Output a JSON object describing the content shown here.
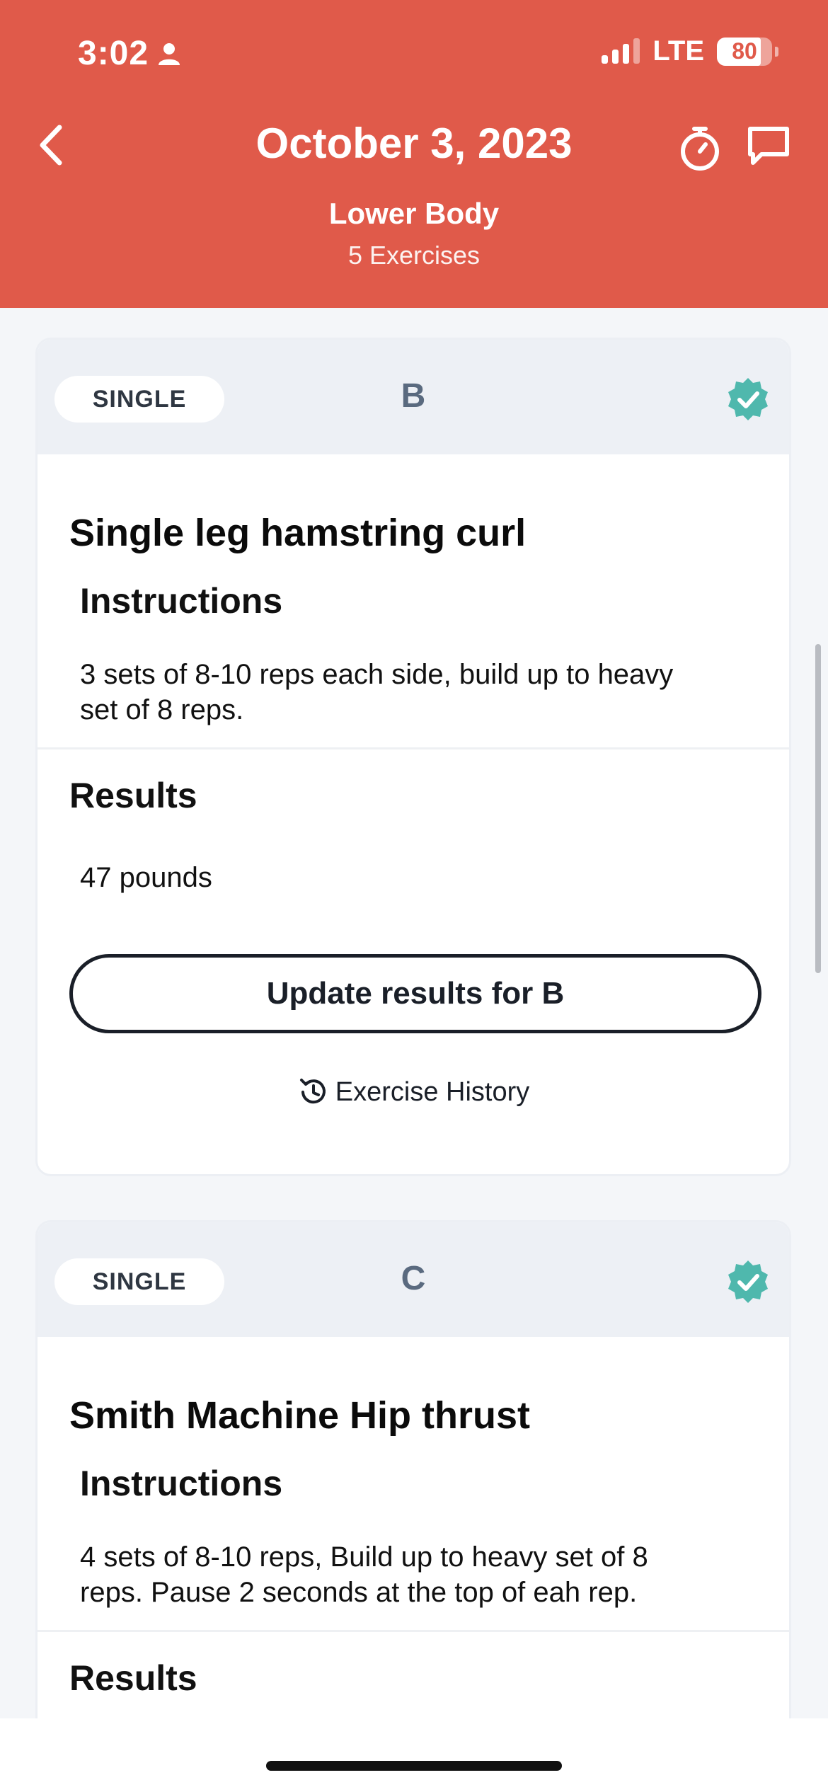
{
  "status": {
    "time": "3:02",
    "network": "LTE",
    "battery": "80"
  },
  "header": {
    "title": "October 3, 2023",
    "subtitle": "Lower Body",
    "count": "5 Exercises"
  },
  "colors": {
    "brand": "#e05a4a",
    "verified": "#4fb8ad"
  },
  "cards": [
    {
      "badge": "SINGLE",
      "letter": "B",
      "name": "Single leg hamstring curl",
      "instructions_title": "Instructions",
      "instructions_line1": "3 sets of 8-10 reps each side, build up to heavy",
      "instructions_line2": "set of 8 reps.",
      "results_title": "Results",
      "results": "47 pounds",
      "update_label": "Update results for B",
      "history_label": "Exercise History"
    },
    {
      "badge": "SINGLE",
      "letter": "C",
      "name": "Smith Machine Hip thrust",
      "instructions_title": "Instructions",
      "instructions_line1": "4 sets of 8-10 reps, Build up to heavy set of 8",
      "instructions_line2": "reps. Pause 2 seconds at the top of eah rep.",
      "results_title": "Results"
    }
  ]
}
